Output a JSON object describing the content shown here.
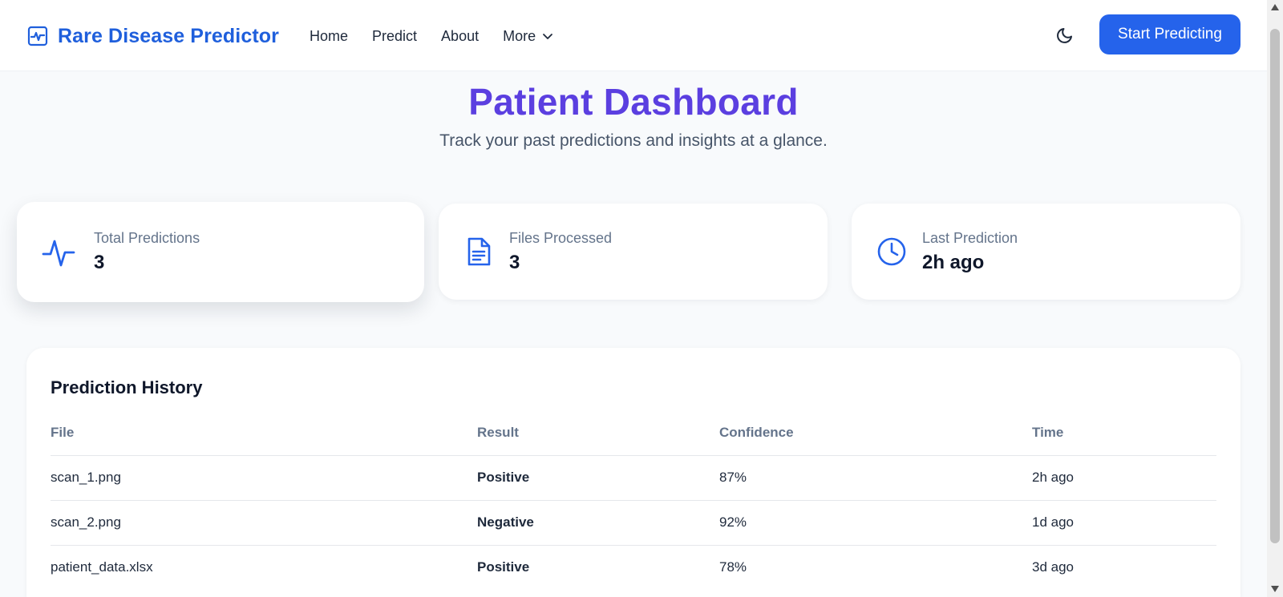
{
  "header": {
    "brand": "Rare Disease Predictor",
    "nav": [
      {
        "label": "Home"
      },
      {
        "label": "Predict"
      },
      {
        "label": "About"
      }
    ],
    "more_label": "More",
    "cta_label": "Start Predicting"
  },
  "hero": {
    "title": "Patient Dashboard",
    "subtitle": "Track your past predictions and insights at a glance."
  },
  "stats": [
    {
      "label": "Total Predictions",
      "value": "3",
      "icon": "activity-icon"
    },
    {
      "label": "Files Processed",
      "value": "3",
      "icon": "file-text-icon"
    },
    {
      "label": "Last Prediction",
      "value": "2h ago",
      "icon": "clock-icon"
    }
  ],
  "history": {
    "title": "Prediction History",
    "columns": [
      "File",
      "Result",
      "Confidence",
      "Time"
    ],
    "rows": [
      {
        "file": "scan_1.png",
        "result": "Positive",
        "confidence": "87%",
        "time": "2h ago"
      },
      {
        "file": "scan_2.png",
        "result": "Negative",
        "confidence": "92%",
        "time": "1d ago"
      },
      {
        "file": "patient_data.xlsx",
        "result": "Positive",
        "confidence": "78%",
        "time": "3d ago"
      }
    ]
  },
  "colors": {
    "brand": "#1f5fdc",
    "accent": "#2563eb",
    "hero_title": "#5b3fe0",
    "positive": "#dc2626",
    "negative": "#16a34a"
  }
}
